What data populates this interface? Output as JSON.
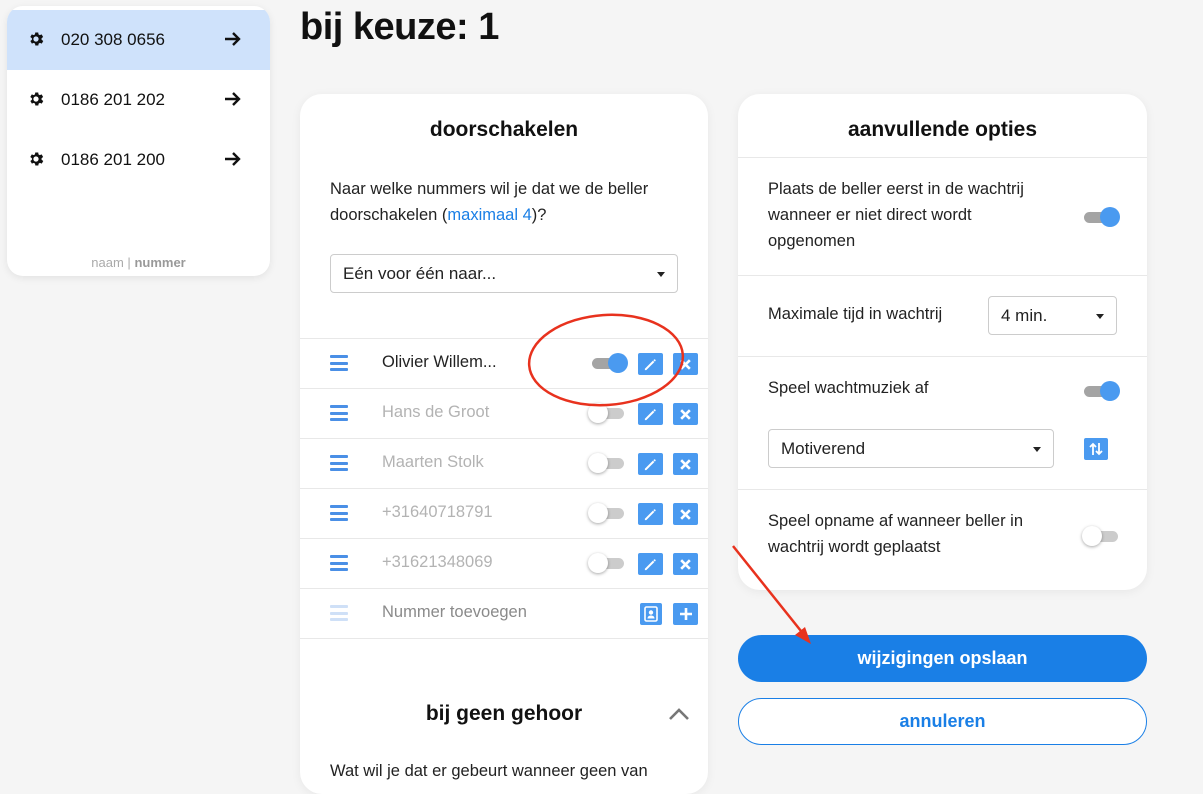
{
  "sidebar": {
    "numbers": [
      {
        "label": "020 308 0656",
        "active": true
      },
      {
        "label": "0186 201 202",
        "active": false
      },
      {
        "label": "0186 201 200",
        "active": false
      }
    ],
    "sort_name": "naam",
    "sort_sep": "|",
    "sort_number": "nummer"
  },
  "page_title": "bij keuze: 1",
  "forward": {
    "title": "doorschakelen",
    "question_pre": "Naar welke nummers wil je dat we de beller doorschakelen (",
    "question_link": "maximaal 4",
    "question_post": ")?",
    "mode_value": "Eén voor één naar...",
    "contacts": [
      {
        "name": "Olivier Willem...",
        "enabled": true
      },
      {
        "name": "Hans de Groot",
        "enabled": false
      },
      {
        "name": "Maarten Stolk",
        "enabled": false
      },
      {
        "name": "+31640718791",
        "enabled": false
      },
      {
        "name": "+31621348069",
        "enabled": false
      }
    ],
    "add_placeholder": "Nummer toevoegen",
    "no_answer_title": "bij geen gehoor",
    "no_answer_text": "Wat wil je dat er gebeurt wanneer geen van"
  },
  "options": {
    "title": "aanvullende opties",
    "queue_first_label": "Plaats de beller eerst in de wachtrij wanneer er niet direct wordt opgenomen",
    "queue_first_on": true,
    "max_wait_label": "Maximale tijd in wachtrij",
    "max_wait_value": "4 min.",
    "music_label": "Speel wachtmuziek af",
    "music_on": true,
    "music_value": "Motiverend",
    "recording_label": "Speel opname af wanneer beller in wachtrij wordt geplaatst",
    "recording_on": false
  },
  "actions": {
    "save": "wijzigingen opslaan",
    "cancel": "annuleren"
  },
  "colors": {
    "accent": "#1a7fe6",
    "icon_button": "#4a9af0",
    "active_row": "#cfe2fb",
    "annotation": "#e8321e"
  }
}
